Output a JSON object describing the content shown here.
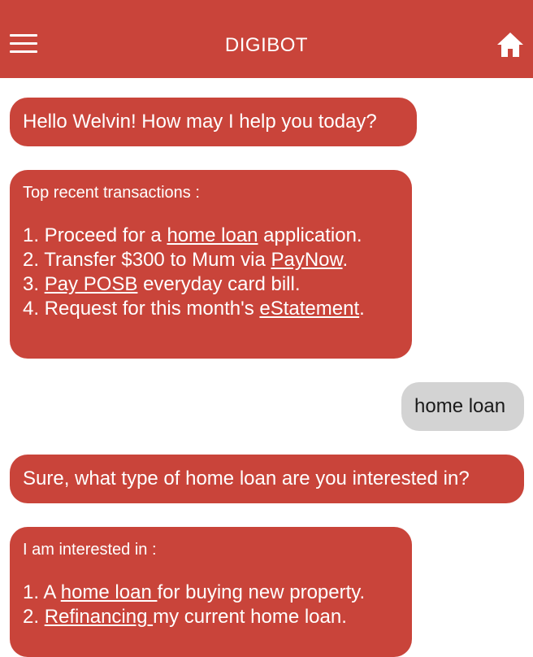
{
  "header": {
    "title": "DIGIBOT",
    "menu_icon": "hamburger-menu-icon",
    "home_icon": "home-icon",
    "bg_color": "#c9443a"
  },
  "messages": {
    "greeting": "Hello Welvin! How may I help you today?",
    "recent": {
      "heading": "Top recent transactions :",
      "items": [
        {
          "prefix": "1. Proceed for a ",
          "link": "home loan",
          "suffix": " application."
        },
        {
          "prefix": "2. Transfer $300 to Mum via ",
          "link": "PayNow",
          "suffix": "."
        },
        {
          "prefix": "3. ",
          "link": "Pay POSB",
          "suffix": " everyday card bill."
        },
        {
          "prefix": "4. Request for this month's ",
          "link": "eStatement",
          "suffix": "."
        }
      ]
    },
    "user_reply": "home loan",
    "question": "Sure, what type of home loan are you interested in?",
    "options": {
      "heading": "I am interested in :",
      "items": [
        {
          "prefix": "1. A ",
          "link": "home loan ",
          "suffix": "for buying new property."
        },
        {
          "prefix": "2. ",
          "link": "Refinancing ",
          "suffix": "my current home loan."
        }
      ]
    }
  },
  "colors": {
    "bot_bubble": "#c9443a",
    "user_bubble": "#d3d3d3"
  }
}
